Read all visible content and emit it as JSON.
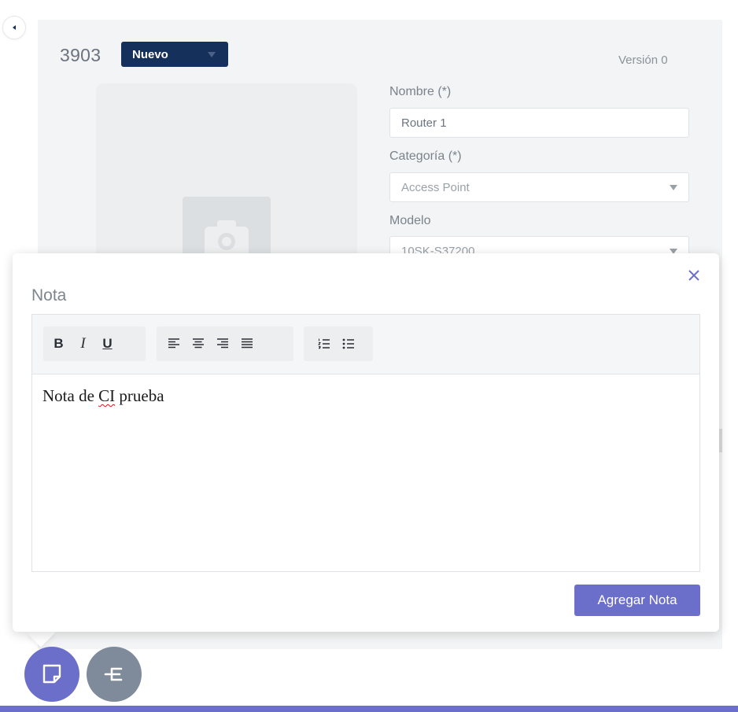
{
  "ci": {
    "id": "3903",
    "status": "Nuevo",
    "version_label": "Versión 0"
  },
  "form": {
    "name_label": "Nombre (*)",
    "name_value": "Router 1",
    "category_label": "Categoría (*)",
    "category_value": "Access Point",
    "model_label": "Modelo",
    "model_value": "10SK-S37200"
  },
  "note_popup": {
    "title": "Nota",
    "toolbar": {
      "bold": "B",
      "italic": "I",
      "underline": "U"
    },
    "content_before": "Nota de ",
    "content_spell": "CI",
    "content_after": " prueba",
    "submit_label": "Agregar Nota"
  },
  "colors": {
    "accent": "#6c6fc9",
    "status_bg": "#15305a",
    "tree_fab": "#7f8a9a"
  },
  "icons": [
    "chevron-left-icon",
    "camera-icon",
    "close-icon",
    "align-left-icon",
    "align-center-icon",
    "align-right-icon",
    "align-justify-icon",
    "ordered-list-icon",
    "unordered-list-icon",
    "note-icon",
    "tree-icon"
  ]
}
